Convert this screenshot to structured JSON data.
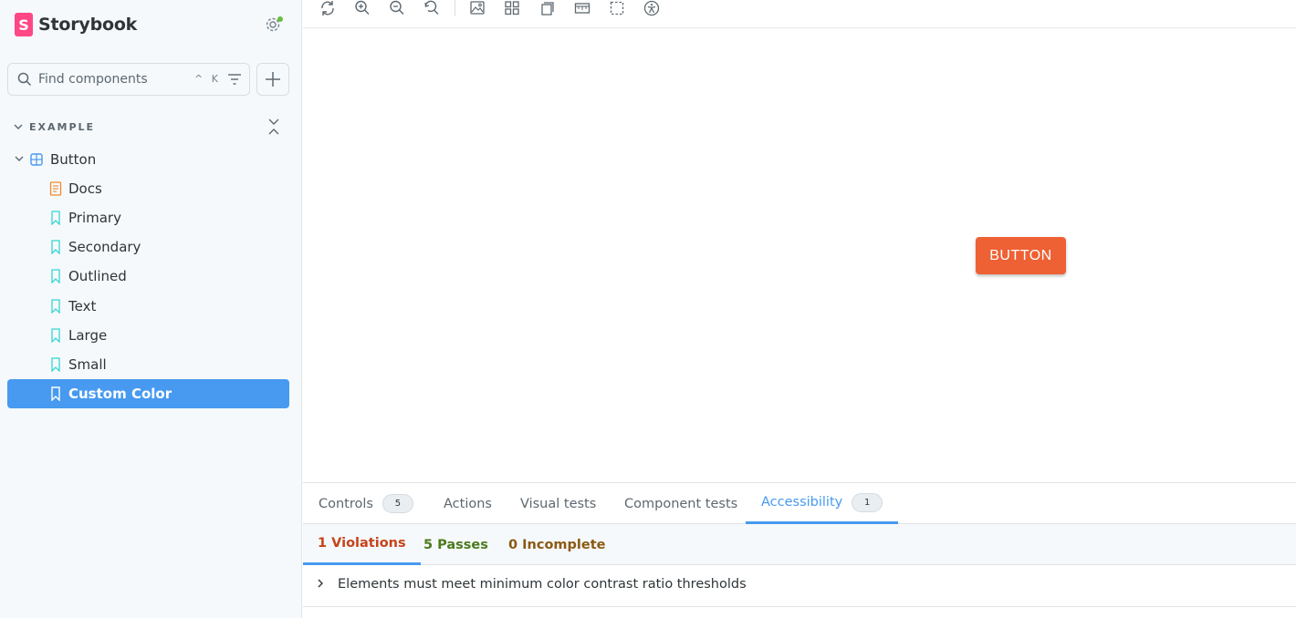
{
  "brand": {
    "logo_letter": "S",
    "name": "Storybook"
  },
  "search": {
    "placeholder": "Find components",
    "shortcut": "^ K"
  },
  "section": {
    "label": "EXAMPLE"
  },
  "tree": {
    "component": "Button",
    "stories": [
      {
        "label": "Docs",
        "kind": "docs"
      },
      {
        "label": "Primary",
        "kind": "story"
      },
      {
        "label": "Secondary",
        "kind": "story"
      },
      {
        "label": "Outlined",
        "kind": "story"
      },
      {
        "label": "Text",
        "kind": "story"
      },
      {
        "label": "Large",
        "kind": "story"
      },
      {
        "label": "Small",
        "kind": "story"
      },
      {
        "label": "Custom Color",
        "kind": "story",
        "selected": true
      }
    ]
  },
  "toolbar": {
    "icons": [
      "reload-icon",
      "zoom-in-icon",
      "zoom-out-icon",
      "zoom-reset-icon",
      "background-icon",
      "grid-icon",
      "viewport-icon",
      "measure-icon",
      "outline-icon",
      "accessibility-icon"
    ]
  },
  "canvas": {
    "button_label": "BUTTON",
    "button_color": "#ee6134"
  },
  "panel": {
    "tabs": [
      {
        "label": "Controls",
        "count": "5"
      },
      {
        "label": "Actions"
      },
      {
        "label": "Visual tests"
      },
      {
        "label": "Component tests"
      },
      {
        "label": "Accessibility",
        "count": "1",
        "active": true
      }
    ],
    "subtabs": {
      "violations": "1 Violations",
      "passes": "5 Passes",
      "incomplete": "0 Incomplete"
    },
    "violation_text": "Elements must meet minimum color contrast ratio thresholds"
  },
  "colors": {
    "accent": "#479af0",
    "brand": "#ff4785",
    "violation": "#c6431a",
    "pass": "#4b7a1c",
    "incomplete": "#8a5a12"
  }
}
